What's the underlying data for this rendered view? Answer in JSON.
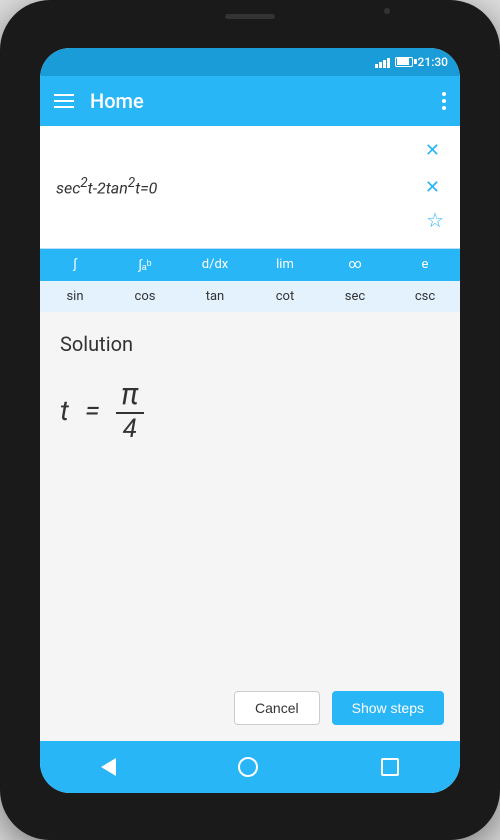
{
  "status_bar": {
    "time": "21:30"
  },
  "app_bar": {
    "title": "Home",
    "menu_icon": "hamburger-icon",
    "more_icon": "more-vert-icon"
  },
  "calculator": {
    "equation": "sec²t-2tan²t=0",
    "clear_icon": "×",
    "star_icon": "☆"
  },
  "keyboard": {
    "row1": [
      "∫",
      "∫ₐᵇ",
      "d/dx",
      "lim",
      "∞",
      "e"
    ],
    "row2": [
      "sin",
      "cos",
      "tan",
      "cot",
      "sec",
      "csc"
    ]
  },
  "solution": {
    "title": "Solution",
    "variable": "t",
    "equals": "=",
    "numerator": "π",
    "denominator": "4"
  },
  "buttons": {
    "cancel": "Cancel",
    "show_steps": "Show steps"
  },
  "nav_bar": {
    "back_icon": "back-icon",
    "home_icon": "home-icon",
    "recents_icon": "recents-icon"
  }
}
